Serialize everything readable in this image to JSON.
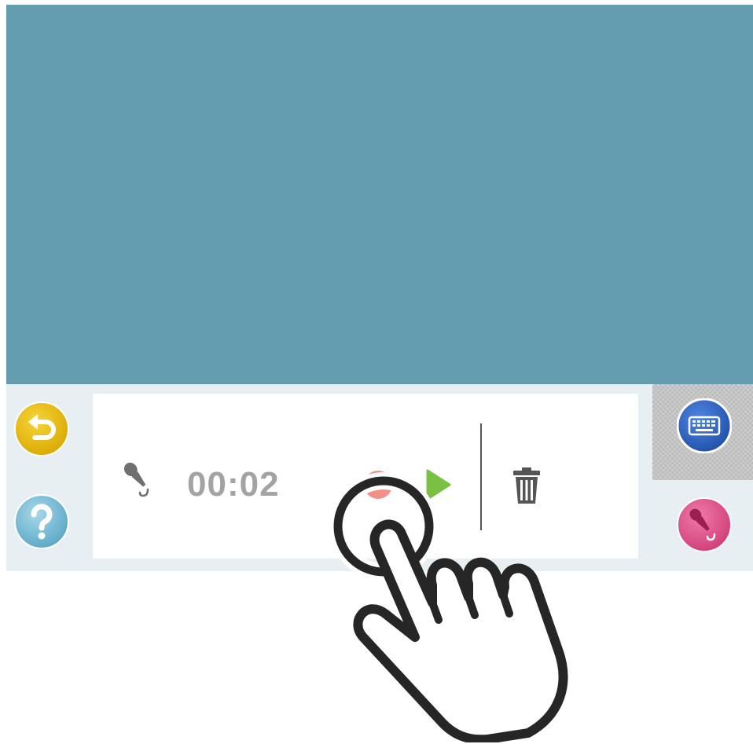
{
  "recorder": {
    "timer": "00:02"
  },
  "icons": {
    "back": "back-arrow-icon",
    "help": "question-mark-icon",
    "mic": "microphone-icon",
    "record": "record-dot-icon",
    "play": "play-triangle-icon",
    "trash": "trash-icon",
    "keyboard": "keyboard-icon",
    "mic_button": "microphone-icon",
    "gesture": "tap-hand-icon"
  },
  "colors": {
    "screen_background": "#649cb0",
    "toolbar_background": "#e8eff3",
    "back_button": "#e5b80b",
    "help_button": "#6db1cd",
    "record_button": "#f28f86",
    "play_button": "#79c043",
    "keyboard_button": "#2f66c3",
    "mic_button": "#de4f8a",
    "timer_text": "#a3a3a3"
  }
}
